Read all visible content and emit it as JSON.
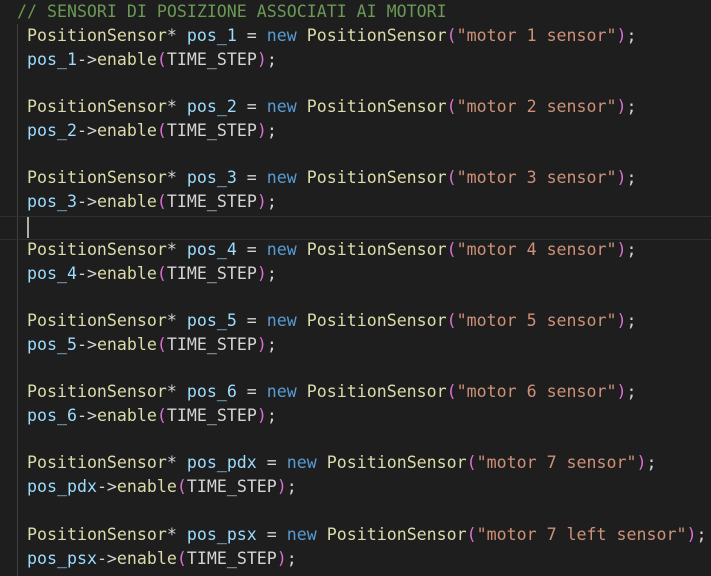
{
  "comment": "// SENSORI DI POSIZIONE ASSOCIATI AI MOTORI",
  "keywords": {
    "type": "PositionSensor",
    "new": "new",
    "enable": "enable",
    "arg": "TIME_STEP"
  },
  "sensors": [
    {
      "var": "pos_1",
      "label": "\"motor 1 sensor\""
    },
    {
      "var": "pos_2",
      "label": "\"motor 2 sensor\""
    },
    {
      "var": "pos_3",
      "label": "\"motor 3 sensor\""
    },
    {
      "var": "pos_4",
      "label": "\"motor 4 sensor\""
    },
    {
      "var": "pos_5",
      "label": "\"motor 5 sensor\""
    },
    {
      "var": "pos_6",
      "label": "\"motor 6 sensor\""
    },
    {
      "var": "pos_pdx",
      "label": "\"motor 7 sensor\""
    },
    {
      "var": "pos_psx",
      "label": "\"motor 7 left sensor\""
    }
  ]
}
